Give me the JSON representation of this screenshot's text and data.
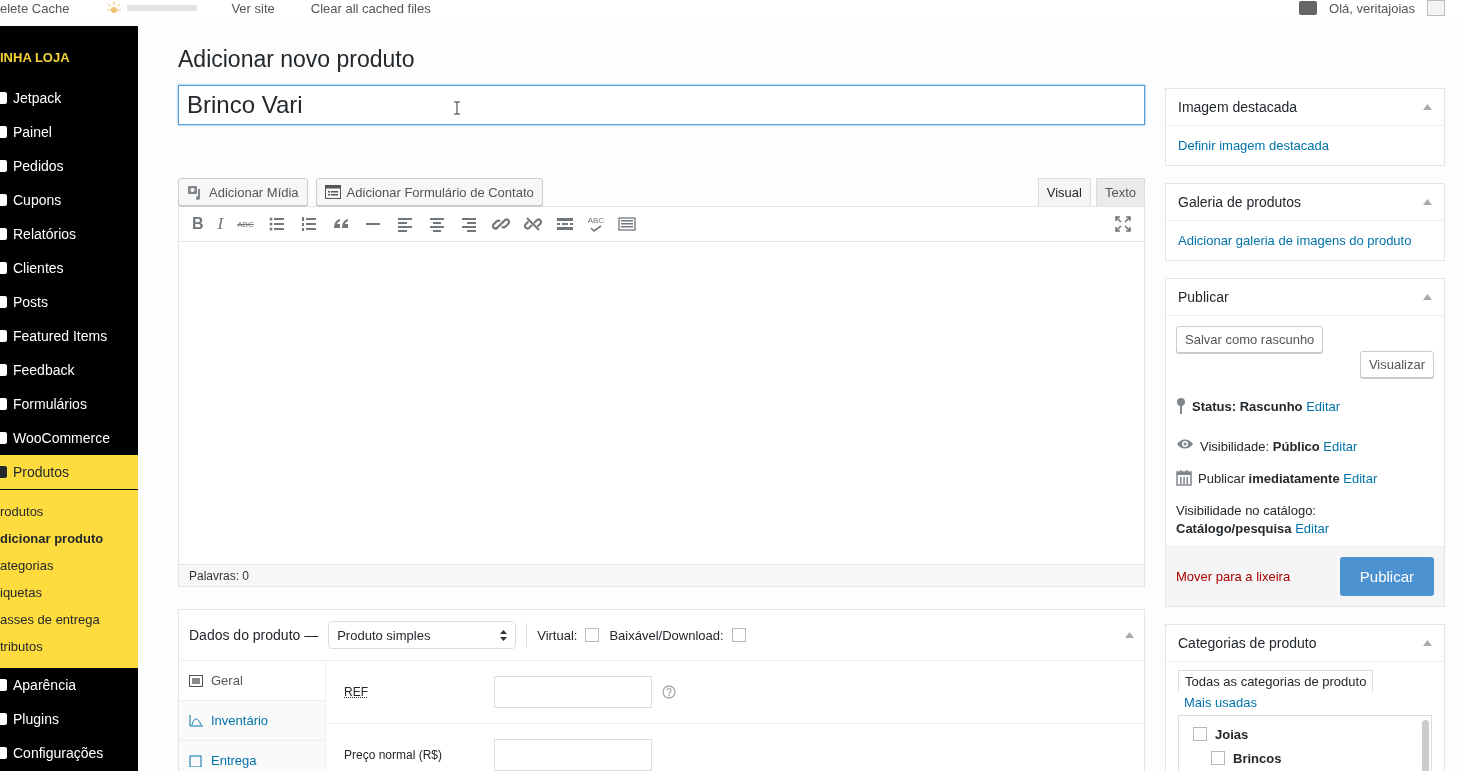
{
  "top_bar": {
    "items": [
      "elete Cache",
      "Ver site",
      "Clear all cached files"
    ],
    "greeting": "Olá, veritajoias"
  },
  "sidebar": {
    "store_title": "INHA LOJA",
    "items": [
      {
        "label": "Jetpack",
        "selected": false
      },
      {
        "label": "Painel",
        "selected": false
      },
      {
        "label": "Pedidos",
        "selected": false
      },
      {
        "label": "Cupons",
        "selected": false
      },
      {
        "label": "Relatórios",
        "selected": false
      },
      {
        "label": "Clientes",
        "selected": false
      },
      {
        "label": "Posts",
        "selected": false
      },
      {
        "label": "Featured Items",
        "selected": false
      },
      {
        "label": "Feedback",
        "selected": false
      },
      {
        "label": "Formulários",
        "selected": false
      },
      {
        "label": "WooCommerce",
        "selected": false
      },
      {
        "label": "Produtos",
        "selected": true,
        "children": [
          {
            "label": "rodutos",
            "selected": false
          },
          {
            "label": "dicionar produto",
            "selected": true
          },
          {
            "label": "ategorias",
            "selected": false
          },
          {
            "label": "iquetas",
            "selected": false
          },
          {
            "label": "asses de entrega",
            "selected": false
          },
          {
            "label": "tributos",
            "selected": false
          }
        ]
      },
      {
        "label": "Aparência",
        "selected": false
      },
      {
        "label": "Plugins",
        "selected": false
      },
      {
        "label": "Configurações",
        "selected": false
      }
    ]
  },
  "page_title": "Adicionar novo produto",
  "title_field": {
    "value": "Brinco Vari"
  },
  "media_buttons": [
    {
      "kind": "media",
      "label": "Adicionar Mídia"
    },
    {
      "kind": "form",
      "label": "Adicionar Formulário de Contato"
    }
  ],
  "editor_tabs": [
    {
      "label": "Visual",
      "selected": true
    },
    {
      "label": "Texto",
      "selected": false
    }
  ],
  "format_buttons": [
    {
      "kind": "bold",
      "text": "B"
    },
    {
      "kind": "italic",
      "text": "I"
    },
    {
      "kind": "strike",
      "text": "ABC"
    },
    {
      "kind": "bullets"
    },
    {
      "kind": "numbers"
    },
    {
      "kind": "quote"
    },
    {
      "kind": "rule"
    },
    {
      "kind": "align-left"
    },
    {
      "kind": "align-center"
    },
    {
      "kind": "align-right"
    },
    {
      "kind": "link"
    },
    {
      "kind": "unlink"
    },
    {
      "kind": "more"
    },
    {
      "kind": "spell",
      "text": "ABC"
    },
    {
      "kind": "keyboard"
    }
  ],
  "word_count": "Palavras: 0",
  "product_data": {
    "title": "Dados do produto —",
    "type_select": "Produto simples",
    "options": [
      {
        "label": "Virtual:",
        "checked": false
      },
      {
        "label": "Baixável/Download:",
        "checked": false
      }
    ],
    "tabs": [
      {
        "kind": "general",
        "label": "Geral",
        "selected": true
      },
      {
        "kind": "inventory",
        "label": "Inventário",
        "selected": false
      },
      {
        "kind": "shipping",
        "label": "Entrega",
        "selected": false
      }
    ],
    "fields": [
      {
        "label": "REF",
        "help": true
      },
      {
        "label": "Preço normal (R$)",
        "help": false
      }
    ]
  },
  "featured_image": {
    "title": "Imagem destacada",
    "link": "Definir imagem destacada"
  },
  "gallery": {
    "title": "Galeria de produtos",
    "link": "Adicionar galeria de imagens do produto"
  },
  "publish": {
    "title": "Publicar",
    "save_draft": "Salvar como rascunho",
    "preview": "Visualizar",
    "lines": [
      {
        "kind": "status",
        "text": "**Status: Rascunho**",
        "edit": "Editar"
      },
      {
        "kind": "visibility",
        "text": "Visibilidade: **Público**",
        "edit": "Editar"
      },
      {
        "kind": "schedule",
        "text": "Publicar **imediatamente**",
        "edit": "Editar"
      },
      {
        "kind": "catalog",
        "text": "Visibilidade no catálogo: **Catálogo/pesquisa**",
        "edit": "Editar"
      }
    ],
    "trash": "Mover para a lixeira",
    "publish_button": "Publicar"
  },
  "categories": {
    "title": "Categorias de produto",
    "tabs": [
      {
        "label": "Todas as categorias de produto",
        "selected": true
      },
      {
        "label": "Mais usadas",
        "selected": false
      }
    ],
    "items": [
      {
        "label": "Joias",
        "checked": false,
        "children": [
          {
            "label": "Brincos",
            "checked": false
          }
        ]
      }
    ]
  }
}
